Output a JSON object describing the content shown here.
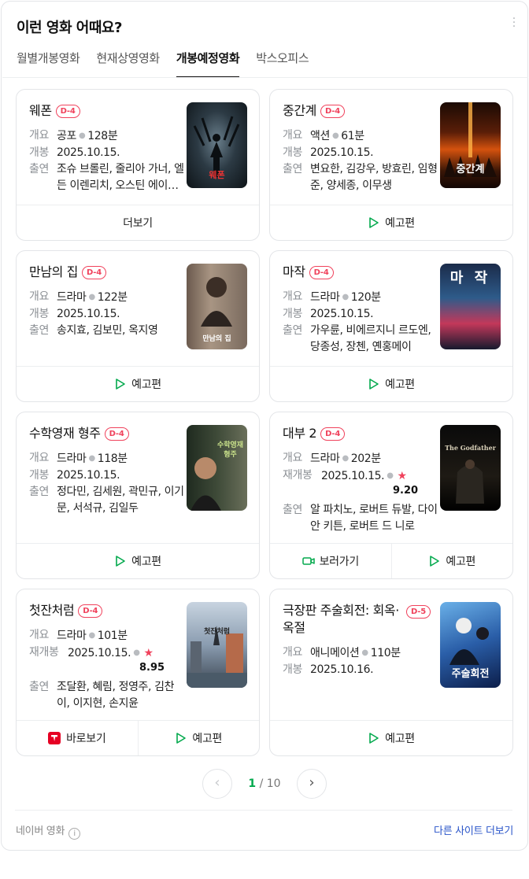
{
  "header": {
    "title": "이런 영화 어때요?"
  },
  "tabs": [
    "월별개봉영화",
    "현재상영영화",
    "개봉예정영화",
    "박스오피스"
  ],
  "labels": {
    "genre": "개요",
    "release": "개봉",
    "rerelease": "재개봉",
    "cast": "출연"
  },
  "movies": [
    {
      "title": "웨폰",
      "badge": "D-4",
      "genre": "공포",
      "runtime": "128분",
      "date": "2025.10.15.",
      "cast": "조슈 브롤린, 줄리아 가너, 엘든 이렌리치, 오스틴 에이브럼스",
      "poster_text": "웨폰",
      "actions": [
        "더보기"
      ]
    },
    {
      "title": "중간계",
      "badge": "D-4",
      "genre": "액션",
      "runtime": "61분",
      "date": "2025.10.15.",
      "cast": "변요한, 김강우, 방효린, 임형준, 양세종, 이무생",
      "poster_text": "중간계",
      "actions": [
        "예고편"
      ]
    },
    {
      "title": "만남의 집",
      "badge": "D-4",
      "genre": "드라마",
      "runtime": "122분",
      "date": "2025.10.15.",
      "cast": "송지효, 김보민, 옥지영",
      "poster_text": "만남의 집",
      "actions": [
        "예고편"
      ]
    },
    {
      "title": "마작",
      "badge": "D-4",
      "genre": "드라마",
      "runtime": "120분",
      "date": "2025.10.15.",
      "cast": "가우륜, 비에르지니 르도엔, 당종성, 장첸, 옌홍메이",
      "poster_text": "마 작",
      "actions": [
        "예고편"
      ]
    },
    {
      "title": "수학영재 형주",
      "badge": "D-4",
      "genre": "드라마",
      "runtime": "118분",
      "date": "2025.10.15.",
      "cast": "정다민, 김세원, 곽민규, 이기문, 서석규, 김일두",
      "poster_text": "수학영재 형주",
      "actions": [
        "예고편"
      ]
    },
    {
      "title": "대부 2",
      "badge": "D-4",
      "genre": "드라마",
      "runtime": "202분",
      "date": "2025.10.15.",
      "rating": "9.20",
      "cast": "알 파치노, 로버트 듀발, 다이안 키튼, 로버트 드 니로",
      "poster_text": "The Godfather",
      "actions": [
        "보러가기",
        "예고편"
      ]
    },
    {
      "title": "첫잔처럼",
      "badge": "D-4",
      "genre": "드라마",
      "runtime": "101분",
      "date": "2025.10.15.",
      "rating": "8.95",
      "cast": "조달환, 혜림, 정영주, 김찬이, 이지현, 손지윤",
      "poster_text": "첫잔처럼",
      "actions": [
        "바로보기",
        "예고편"
      ]
    },
    {
      "title": "극장판 주술회전: 회옥·옥절",
      "badge": "D-5",
      "genre": "애니메이션",
      "runtime": "110분",
      "date": "2025.10.16.",
      "poster_text": "주술회전",
      "actions": [
        "예고편"
      ]
    }
  ],
  "pagination": {
    "current": "1",
    "total": "/ 10"
  },
  "footer": {
    "source": "네이버 영화",
    "info_icon": "i",
    "link": "다른 사이트 더보기"
  },
  "colors": {
    "accent_green": "#03a94d",
    "badge_red": "#f0425c",
    "link_blue": "#2a55c9"
  }
}
